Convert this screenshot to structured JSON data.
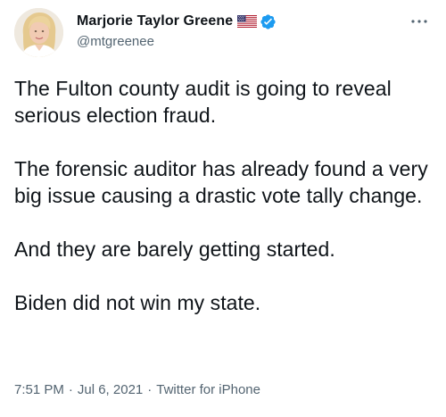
{
  "author": {
    "display_name": "Marjorie Taylor Greene",
    "handle": "@mtgreenee",
    "avatar_icon": "profile-photo",
    "flag_icon": "us-flag-icon",
    "verified_icon": "verified-badge-icon",
    "verified_color": "#1d9bf0"
  },
  "menu": {
    "more_icon": "more-horizontal-icon"
  },
  "tweet": {
    "paragraphs": [
      "The Fulton county audit is going to reveal serious election fraud.",
      "The forensic auditor has already found a very big issue causing a drastic vote tally change.",
      "And they are barely getting started.",
      "Biden did not win my state."
    ]
  },
  "meta": {
    "time": "7:51 PM",
    "separator": "·",
    "date": "Jul 6, 2021",
    "source": "Twitter for iPhone"
  },
  "colors": {
    "text_primary": "#0f1419",
    "text_secondary": "#536471",
    "background": "#ffffff"
  }
}
